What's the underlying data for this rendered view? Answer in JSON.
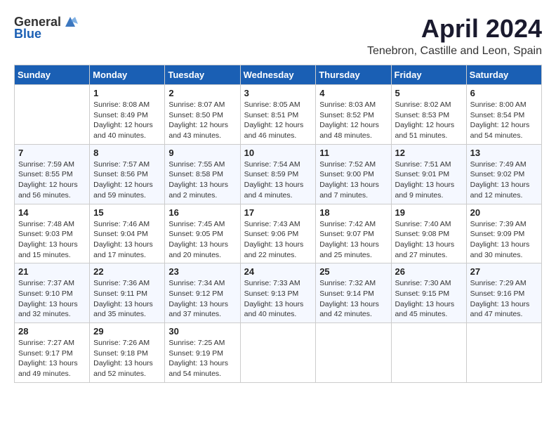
{
  "header": {
    "logo_general": "General",
    "logo_blue": "Blue",
    "month": "April 2024",
    "location": "Tenebron, Castille and Leon, Spain"
  },
  "weekdays": [
    "Sunday",
    "Monday",
    "Tuesday",
    "Wednesday",
    "Thursday",
    "Friday",
    "Saturday"
  ],
  "weeks": [
    [
      {
        "day": "",
        "info": ""
      },
      {
        "day": "1",
        "info": "Sunrise: 8:08 AM\nSunset: 8:49 PM\nDaylight: 12 hours\nand 40 minutes."
      },
      {
        "day": "2",
        "info": "Sunrise: 8:07 AM\nSunset: 8:50 PM\nDaylight: 12 hours\nand 43 minutes."
      },
      {
        "day": "3",
        "info": "Sunrise: 8:05 AM\nSunset: 8:51 PM\nDaylight: 12 hours\nand 46 minutes."
      },
      {
        "day": "4",
        "info": "Sunrise: 8:03 AM\nSunset: 8:52 PM\nDaylight: 12 hours\nand 48 minutes."
      },
      {
        "day": "5",
        "info": "Sunrise: 8:02 AM\nSunset: 8:53 PM\nDaylight: 12 hours\nand 51 minutes."
      },
      {
        "day": "6",
        "info": "Sunrise: 8:00 AM\nSunset: 8:54 PM\nDaylight: 12 hours\nand 54 minutes."
      }
    ],
    [
      {
        "day": "7",
        "info": "Sunrise: 7:59 AM\nSunset: 8:55 PM\nDaylight: 12 hours\nand 56 minutes."
      },
      {
        "day": "8",
        "info": "Sunrise: 7:57 AM\nSunset: 8:56 PM\nDaylight: 12 hours\nand 59 minutes."
      },
      {
        "day": "9",
        "info": "Sunrise: 7:55 AM\nSunset: 8:58 PM\nDaylight: 13 hours\nand 2 minutes."
      },
      {
        "day": "10",
        "info": "Sunrise: 7:54 AM\nSunset: 8:59 PM\nDaylight: 13 hours\nand 4 minutes."
      },
      {
        "day": "11",
        "info": "Sunrise: 7:52 AM\nSunset: 9:00 PM\nDaylight: 13 hours\nand 7 minutes."
      },
      {
        "day": "12",
        "info": "Sunrise: 7:51 AM\nSunset: 9:01 PM\nDaylight: 13 hours\nand 9 minutes."
      },
      {
        "day": "13",
        "info": "Sunrise: 7:49 AM\nSunset: 9:02 PM\nDaylight: 13 hours\nand 12 minutes."
      }
    ],
    [
      {
        "day": "14",
        "info": "Sunrise: 7:48 AM\nSunset: 9:03 PM\nDaylight: 13 hours\nand 15 minutes."
      },
      {
        "day": "15",
        "info": "Sunrise: 7:46 AM\nSunset: 9:04 PM\nDaylight: 13 hours\nand 17 minutes."
      },
      {
        "day": "16",
        "info": "Sunrise: 7:45 AM\nSunset: 9:05 PM\nDaylight: 13 hours\nand 20 minutes."
      },
      {
        "day": "17",
        "info": "Sunrise: 7:43 AM\nSunset: 9:06 PM\nDaylight: 13 hours\nand 22 minutes."
      },
      {
        "day": "18",
        "info": "Sunrise: 7:42 AM\nSunset: 9:07 PM\nDaylight: 13 hours\nand 25 minutes."
      },
      {
        "day": "19",
        "info": "Sunrise: 7:40 AM\nSunset: 9:08 PM\nDaylight: 13 hours\nand 27 minutes."
      },
      {
        "day": "20",
        "info": "Sunrise: 7:39 AM\nSunset: 9:09 PM\nDaylight: 13 hours\nand 30 minutes."
      }
    ],
    [
      {
        "day": "21",
        "info": "Sunrise: 7:37 AM\nSunset: 9:10 PM\nDaylight: 13 hours\nand 32 minutes."
      },
      {
        "day": "22",
        "info": "Sunrise: 7:36 AM\nSunset: 9:11 PM\nDaylight: 13 hours\nand 35 minutes."
      },
      {
        "day": "23",
        "info": "Sunrise: 7:34 AM\nSunset: 9:12 PM\nDaylight: 13 hours\nand 37 minutes."
      },
      {
        "day": "24",
        "info": "Sunrise: 7:33 AM\nSunset: 9:13 PM\nDaylight: 13 hours\nand 40 minutes."
      },
      {
        "day": "25",
        "info": "Sunrise: 7:32 AM\nSunset: 9:14 PM\nDaylight: 13 hours\nand 42 minutes."
      },
      {
        "day": "26",
        "info": "Sunrise: 7:30 AM\nSunset: 9:15 PM\nDaylight: 13 hours\nand 45 minutes."
      },
      {
        "day": "27",
        "info": "Sunrise: 7:29 AM\nSunset: 9:16 PM\nDaylight: 13 hours\nand 47 minutes."
      }
    ],
    [
      {
        "day": "28",
        "info": "Sunrise: 7:27 AM\nSunset: 9:17 PM\nDaylight: 13 hours\nand 49 minutes."
      },
      {
        "day": "29",
        "info": "Sunrise: 7:26 AM\nSunset: 9:18 PM\nDaylight: 13 hours\nand 52 minutes."
      },
      {
        "day": "30",
        "info": "Sunrise: 7:25 AM\nSunset: 9:19 PM\nDaylight: 13 hours\nand 54 minutes."
      },
      {
        "day": "",
        "info": ""
      },
      {
        "day": "",
        "info": ""
      },
      {
        "day": "",
        "info": ""
      },
      {
        "day": "",
        "info": ""
      }
    ]
  ]
}
